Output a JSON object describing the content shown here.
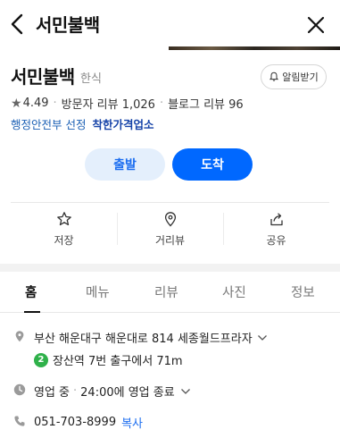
{
  "header": {
    "title": "서민불백"
  },
  "place": {
    "name": "서민불백",
    "category": "한식",
    "rating": "4.49",
    "visitor_reviews": "방문자 리뷰 1,026",
    "blog_reviews": "블로그 리뷰 96",
    "alarm_label": "알림받기",
    "designation_prefix": "행정안전부 선정",
    "designation": "착한가격업소"
  },
  "route": {
    "depart_label": "출발",
    "arrive_label": "도착"
  },
  "actions": [
    {
      "label": "저장",
      "icon": "star-icon"
    },
    {
      "label": "거리뷰",
      "icon": "location-pin-icon"
    },
    {
      "label": "공유",
      "icon": "share-icon"
    }
  ],
  "tabs": [
    {
      "label": "홈",
      "active": true
    },
    {
      "label": "메뉴",
      "active": false
    },
    {
      "label": "리뷰",
      "active": false
    },
    {
      "label": "사진",
      "active": false
    },
    {
      "label": "정보",
      "active": false
    }
  ],
  "info": {
    "address": "부산 해운대구 해운대로 814 세종월드프라자",
    "transit_line": "2",
    "transit_text": "장산역 7번 출구에서 71m",
    "status": "영업 중",
    "hours": "24:00에 영업 종료",
    "phone": "051-703-8999",
    "copy_label": "복사"
  },
  "colors": {
    "accent": "#0068ff",
    "accent_light": "#e4effc",
    "line2": "#2fb14a",
    "link": "#1a5fb4"
  }
}
